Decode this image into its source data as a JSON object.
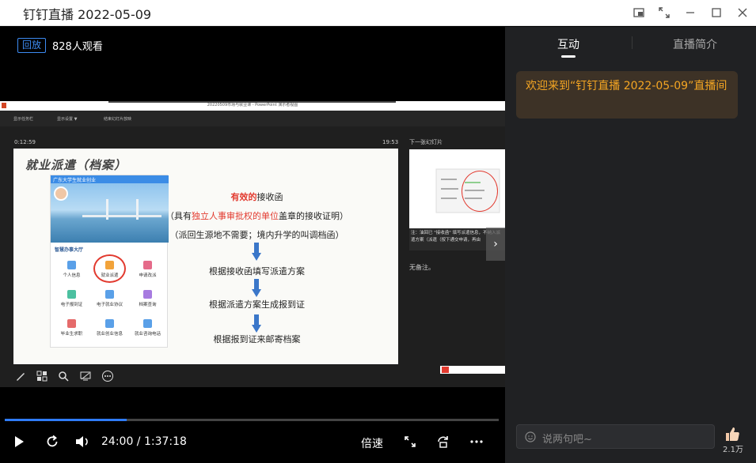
{
  "window": {
    "title": "钉钉直播 2022-05-09"
  },
  "player": {
    "replay_badge": "回放",
    "viewers": "828人观看",
    "time_display": "24:00 / 1:37:18",
    "progress_percent": 24.7,
    "speed_label": "倍速"
  },
  "ppt": {
    "window_title": "20220509市场与就业课 - PowerPoint 演示者视图",
    "tools": [
      "显示任务栏",
      "显示设置 ▼",
      "结束幻灯片放映"
    ],
    "elapsed": "0:12:59",
    "clock": "19:53",
    "next_slide_label": "下一张幻灯片",
    "notes": "无备注。",
    "next_thumb_text": "注：油回已 \"接收函\" 填写派遣信息，不纳入派遣方案（派遣（按下通交申请，再由"
  },
  "slide": {
    "title": "就业派遣（档案）",
    "phone_header": "广东大学生就业创业",
    "phone_section": "智慧办事大厅",
    "grid": [
      "个人信息",
      "就业派遣",
      "申请改派",
      "电子报到证",
      "电子就业协议",
      "档案查询",
      "毕业生求职",
      "就业创业信息",
      "就业咨询电话"
    ],
    "line1_red": "有效的",
    "line1_rest": "接收函",
    "line2_pre": "（具有",
    "line2_red": "独立人事审批权的单位",
    "line2_post": "盖章的接收证明）",
    "line3": "（派回生源地不需要；境内升学的叫调档函）",
    "step1": "根据接收函填写派遣方案",
    "step2": "根据派遣方案生成报到证",
    "step3": "根据报到证来邮寄档案"
  },
  "side": {
    "tab_interact": "互动",
    "tab_intro": "直播简介",
    "welcome": "欢迎来到“钉钉直播 2022-05-09”直播间",
    "input_placeholder": "说两句吧~",
    "like_count": "2.1万"
  },
  "colors": {
    "accent_blue": "#2f7cf6",
    "welcome_text": "#f5a623",
    "slide_red": "#e23a2f"
  }
}
